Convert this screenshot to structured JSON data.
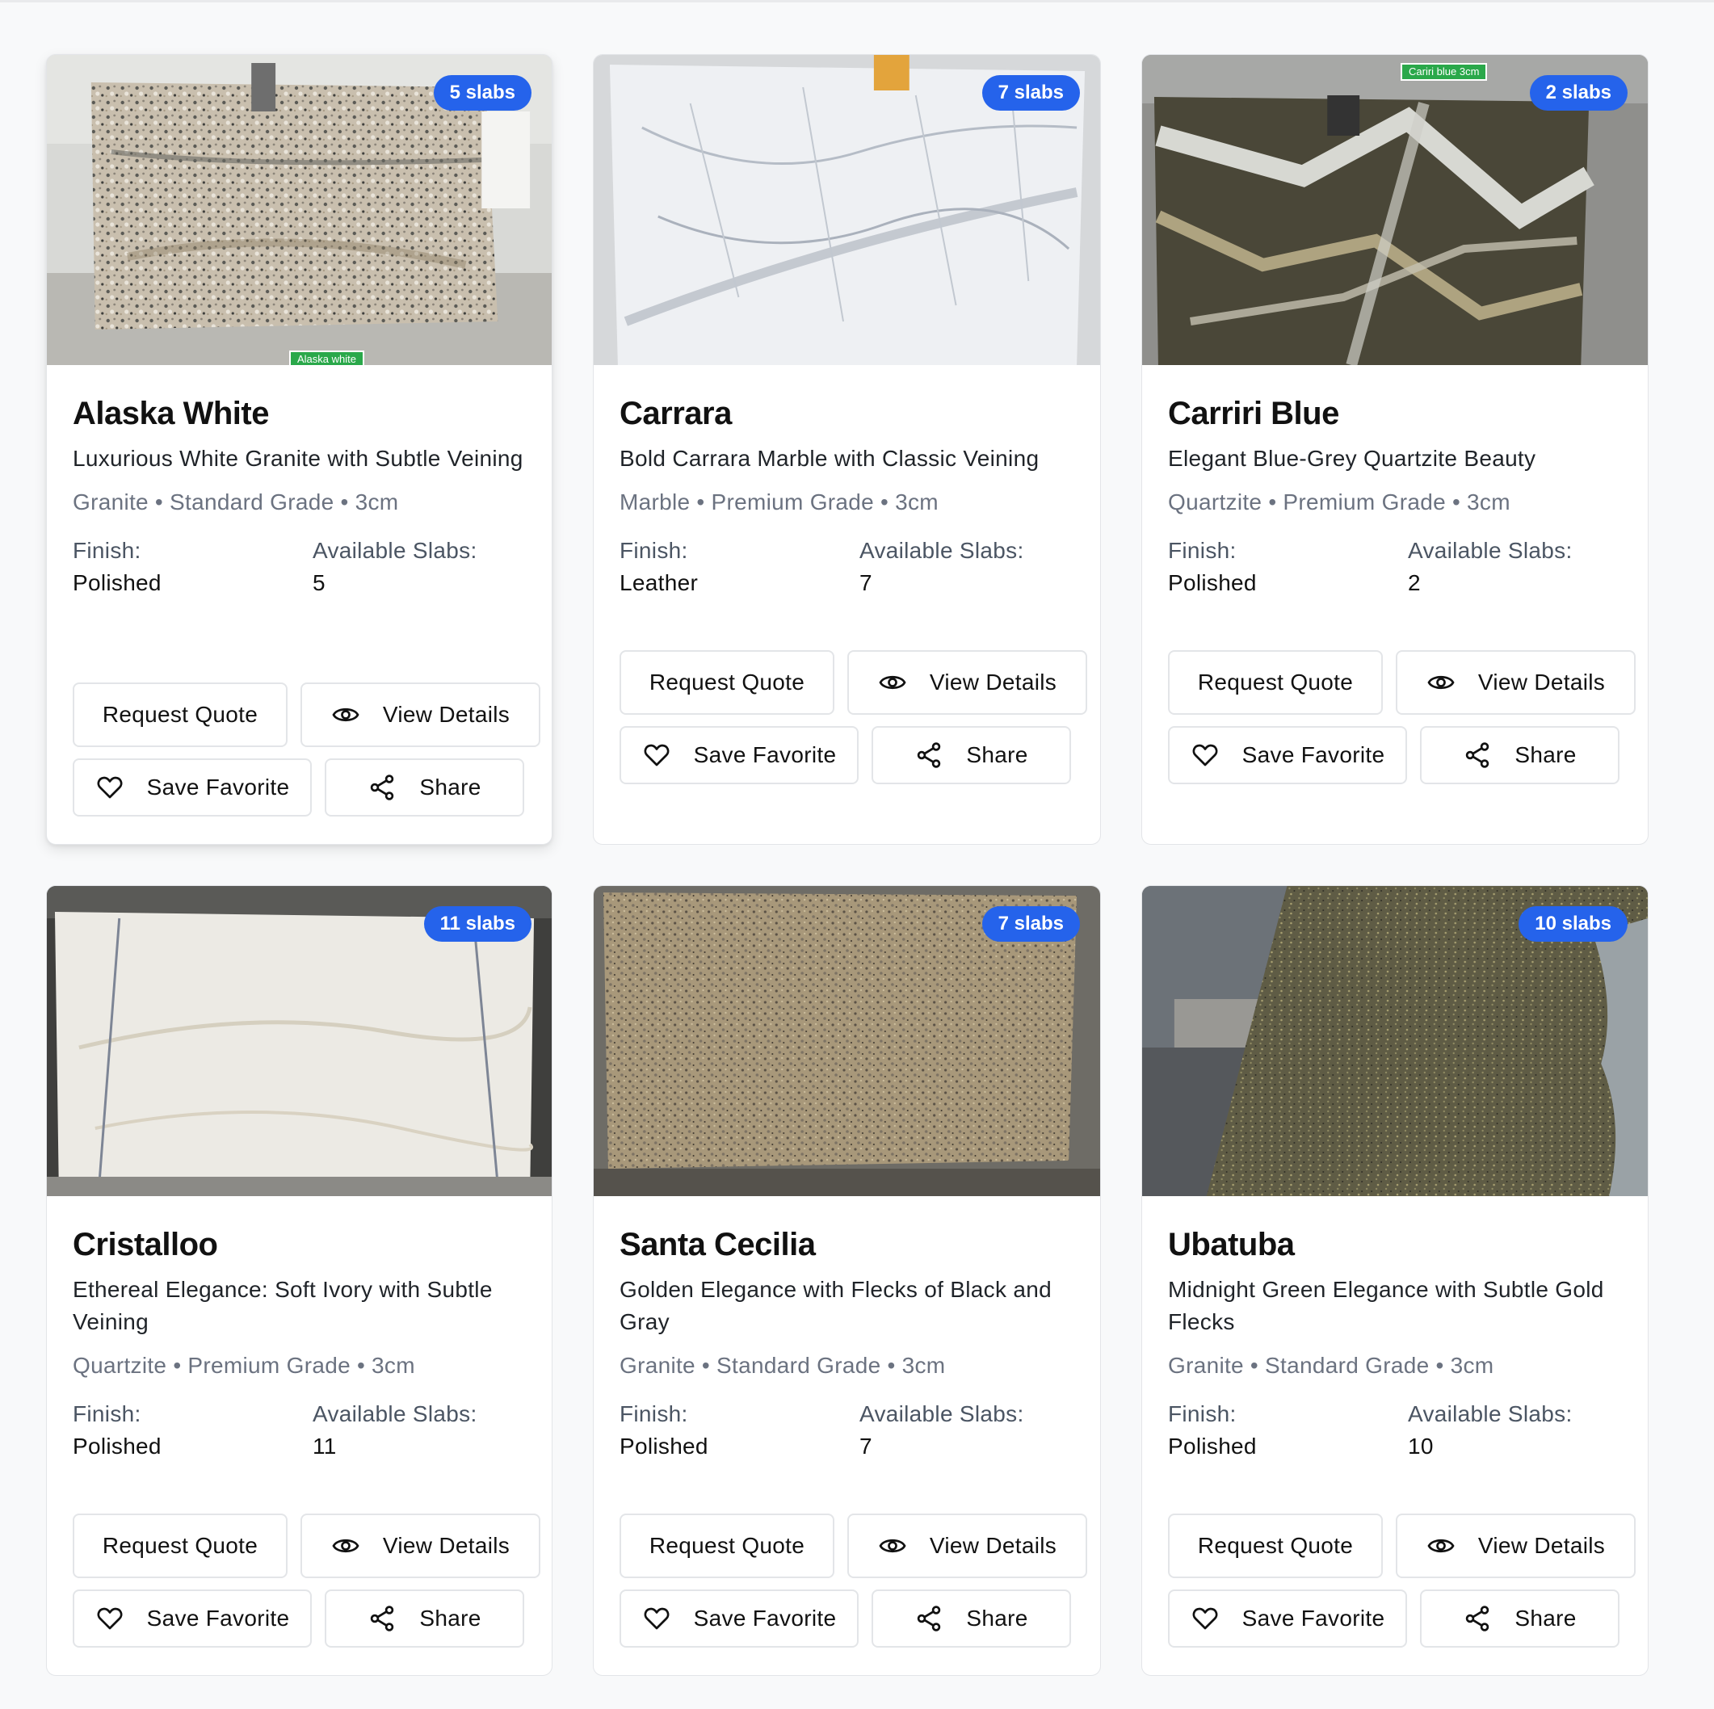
{
  "cards": [
    {
      "badge": "5 slabs",
      "photo_tag": "Alaska white",
      "name": "Alaska White",
      "tagline": "Luxurious White Granite with Subtle Veining",
      "material": "Granite",
      "grade": "Standard Grade",
      "thickness": "3cm",
      "finish_label": "Finish:",
      "finish": "Polished",
      "slabs_label": "Available Slabs:",
      "slabs": "5",
      "buttons": {
        "quote": "Request Quote",
        "view": "View Details",
        "fav": "Save Favorite",
        "share": "Share"
      }
    },
    {
      "badge": "7 slabs",
      "photo_tag": "",
      "name": "Carrara",
      "tagline": "Bold Carrara Marble with Classic Veining",
      "material": "Marble",
      "grade": "Premium Grade",
      "thickness": "3cm",
      "finish_label": "Finish:",
      "finish": "Leather",
      "slabs_label": "Available Slabs:",
      "slabs": "7",
      "buttons": {
        "quote": "Request Quote",
        "view": "View Details",
        "fav": "Save Favorite",
        "share": "Share"
      }
    },
    {
      "badge": "2 slabs",
      "photo_tag": "Cariri blue 3cm",
      "name": "Carriri Blue",
      "tagline": "Elegant Blue-Grey Quartzite Beauty",
      "material": "Quartzite",
      "grade": "Premium Grade",
      "thickness": "3cm",
      "finish_label": "Finish:",
      "finish": "Polished",
      "slabs_label": "Available Slabs:",
      "slabs": "2",
      "buttons": {
        "quote": "Request Quote",
        "view": "View Details",
        "fav": "Save Favorite",
        "share": "Share"
      }
    },
    {
      "badge": "11 slabs",
      "photo_tag": "",
      "name": "Cristalloo",
      "tagline": "Ethereal Elegance: Soft Ivory with Subtle Veining",
      "material": "Quartzite",
      "grade": "Premium Grade",
      "thickness": "3cm",
      "finish_label": "Finish:",
      "finish": "Polished",
      "slabs_label": "Available Slabs:",
      "slabs": "11",
      "buttons": {
        "quote": "Request Quote",
        "view": "View Details",
        "fav": "Save Favorite",
        "share": "Share"
      }
    },
    {
      "badge": "7 slabs",
      "photo_tag": "",
      "name": "Santa Cecilia",
      "tagline": "Golden Elegance with Flecks of Black and Gray",
      "material": "Granite",
      "grade": "Standard Grade",
      "thickness": "3cm",
      "finish_label": "Finish:",
      "finish": "Polished",
      "slabs_label": "Available Slabs:",
      "slabs": "7",
      "buttons": {
        "quote": "Request Quote",
        "view": "View Details",
        "fav": "Save Favorite",
        "share": "Share"
      }
    },
    {
      "badge": "10 slabs",
      "photo_tag": "",
      "name": "Ubatuba",
      "tagline": "Midnight Green Elegance with Subtle Gold Flecks",
      "material": "Granite",
      "grade": "Standard Grade",
      "thickness": "3cm",
      "finish_label": "Finish:",
      "finish": "Polished",
      "slabs_label": "Available Slabs:",
      "slabs": "10",
      "buttons": {
        "quote": "Request Quote",
        "view": "View Details",
        "fav": "Save Favorite",
        "share": "Share"
      }
    }
  ],
  "colors": {
    "badge": "#2563eb",
    "page_background": "#f8f9fa",
    "card_border": "#e3e5e8",
    "meta_text": "#6b7280"
  },
  "icons": {
    "view": "eye-icon",
    "fav": "heart-icon",
    "share": "share-icon"
  }
}
